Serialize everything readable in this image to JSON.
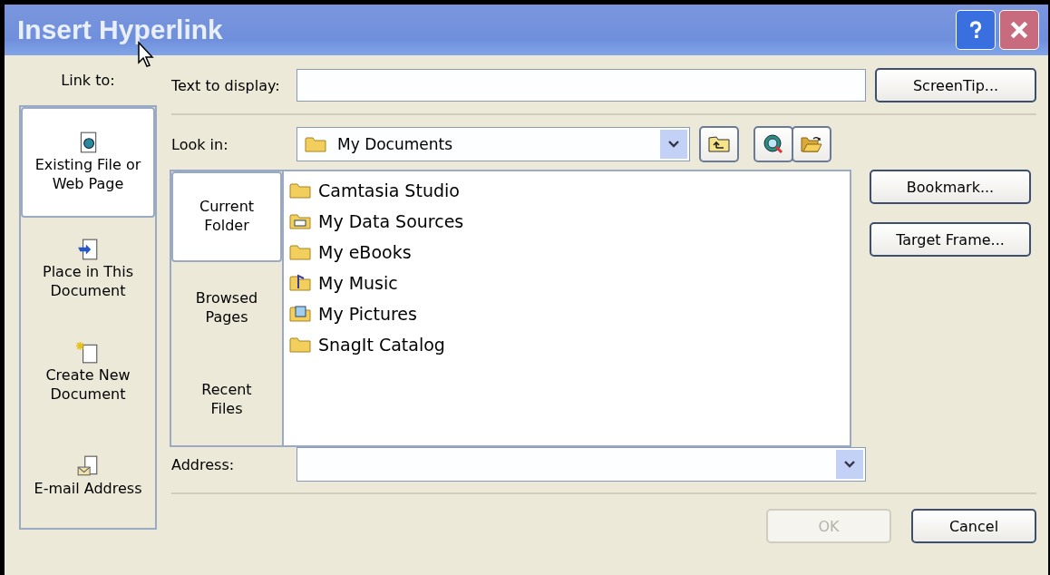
{
  "window": {
    "title": "Insert Hyperlink"
  },
  "link_to": {
    "label": "Link to:",
    "items": [
      {
        "label": "Existing File or Web Page",
        "kind": "file",
        "selected": true
      },
      {
        "label": "Place in This Document",
        "kind": "place",
        "selected": false
      },
      {
        "label": "Create New Document",
        "kind": "new",
        "selected": false
      },
      {
        "label": "E-mail Address",
        "kind": "email",
        "selected": false
      }
    ]
  },
  "text_to_display": {
    "label": "Text to display:"
  },
  "look_in": {
    "label": "Look in:",
    "value": "My Documents"
  },
  "browse_tabs": [
    {
      "label": "Current Folder",
      "selected": true
    },
    {
      "label": "Browsed Pages",
      "selected": false
    },
    {
      "label": "Recent Files",
      "selected": false
    }
  ],
  "files": [
    {
      "name": "Camtasia Studio",
      "kind": "folder"
    },
    {
      "name": "My Data Sources",
      "kind": "data"
    },
    {
      "name": "My eBooks",
      "kind": "folder"
    },
    {
      "name": "My Music",
      "kind": "music"
    },
    {
      "name": "My Pictures",
      "kind": "pictures"
    },
    {
      "name": "SnagIt Catalog",
      "kind": "folder"
    }
  ],
  "address": {
    "label": "Address:"
  },
  "side_buttons": [
    {
      "label": "ScreenTip..."
    },
    {
      "label": "Bookmark..."
    },
    {
      "label": "Target Frame..."
    }
  ],
  "footer_buttons": [
    {
      "label": "OK",
      "disabled": true
    },
    {
      "label": "Cancel",
      "disabled": false
    }
  ]
}
